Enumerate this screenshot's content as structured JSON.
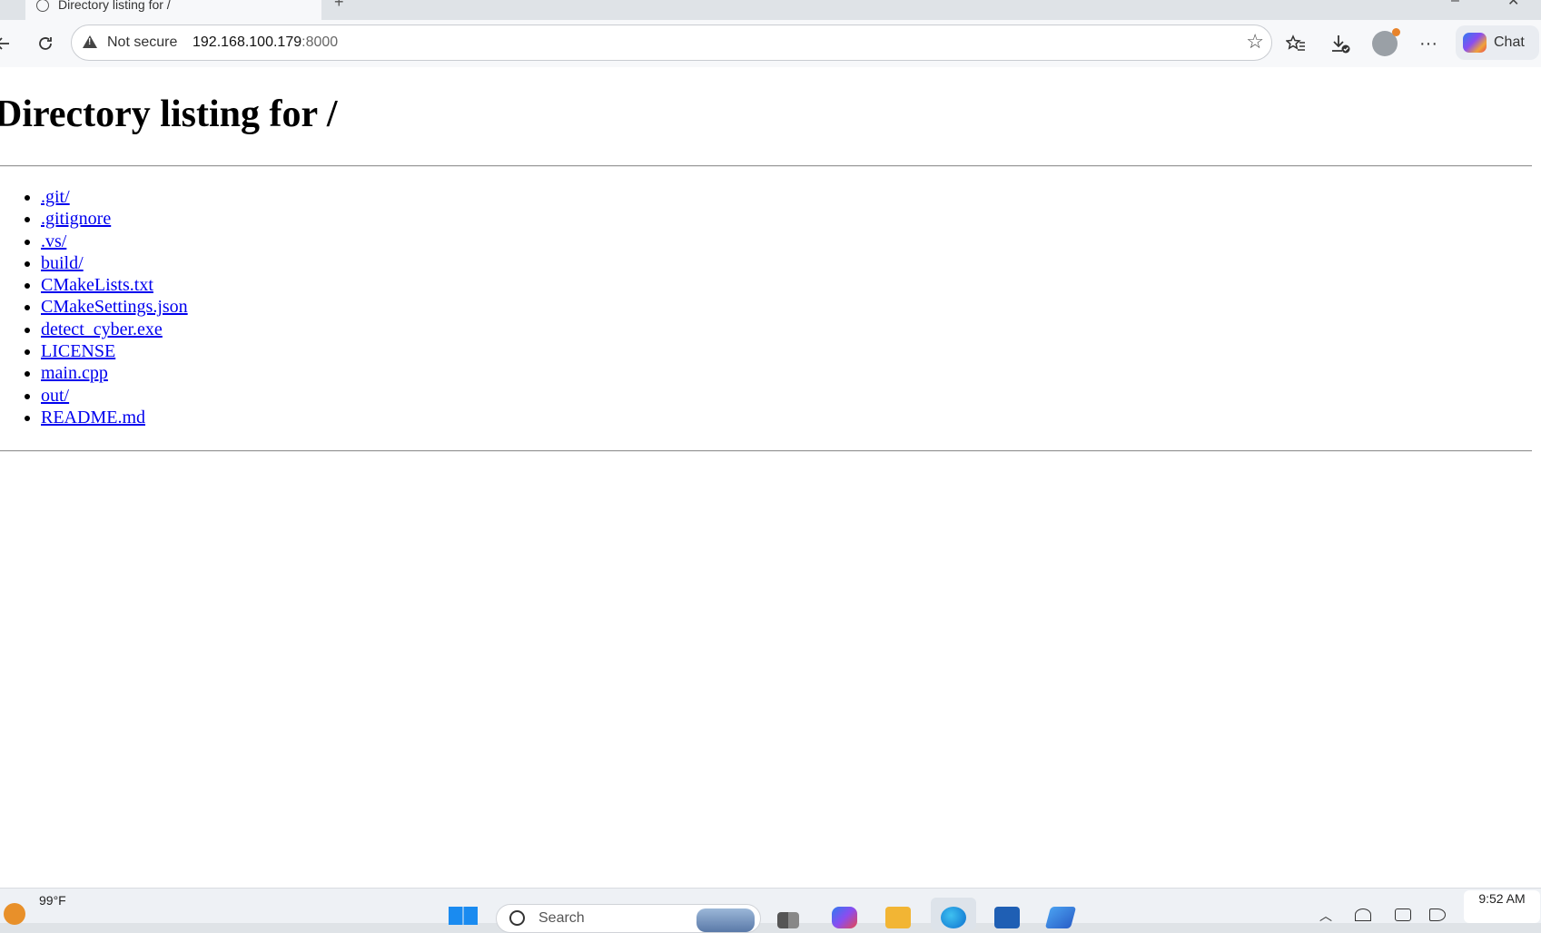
{
  "browser": {
    "tab_title": "Directory listing for /",
    "new_tab_glyph": "+",
    "address": {
      "security_label": "Not secure",
      "host": "192.168.100.179",
      "port": ":8000"
    },
    "chat_label": "Chat"
  },
  "page": {
    "title": "Directory listing for /",
    "files": [
      ".git/",
      ".gitignore",
      ".vs/",
      "build/",
      "CMakeLists.txt",
      "CMakeSettings.json",
      "detect_cyber.exe",
      "LICENSE",
      "main.cpp",
      "out/",
      "README.md"
    ]
  },
  "taskbar": {
    "weather_temp": "99°F",
    "search_placeholder": "Search",
    "time": "9:52 AM"
  },
  "colors": {
    "link": "#0000ee",
    "toolbar_bg": "#f7f8fa",
    "tabstrip_bg": "#dfe3e7"
  },
  "icons": {
    "back": "arrow-left-icon",
    "reload": "reload-icon",
    "warning": "warning-triangle-icon",
    "favorite": "star-icon",
    "favorites_list": "favorites-list-icon",
    "downloads": "download-icon",
    "profile": "profile-avatar-icon",
    "more": "ellipsis-icon",
    "copilot": "copilot-icon"
  }
}
